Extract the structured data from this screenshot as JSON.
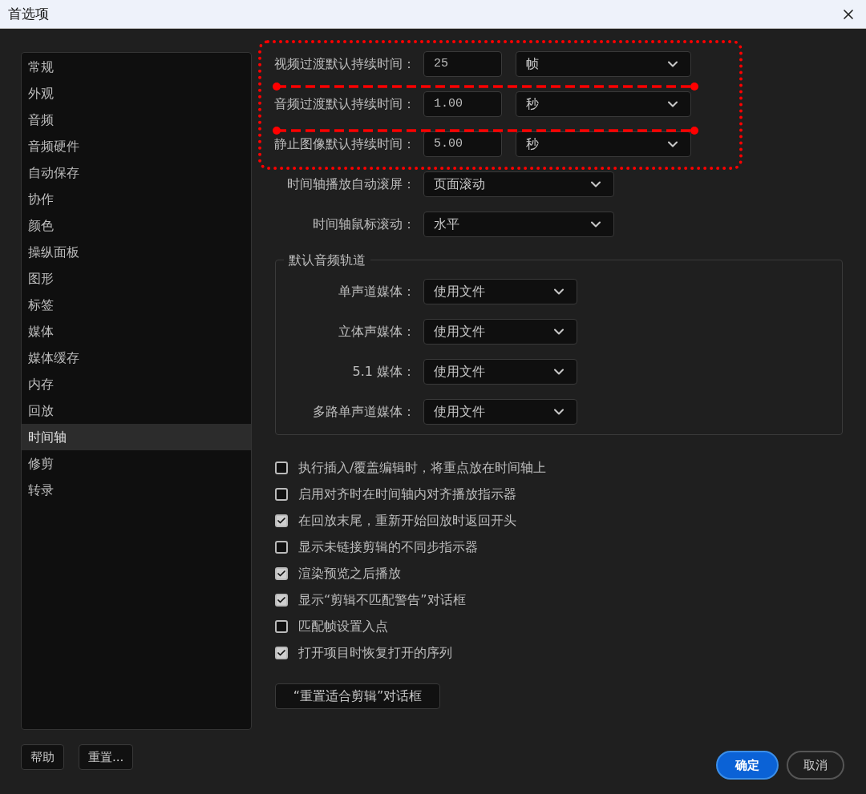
{
  "window": {
    "title": "首选项"
  },
  "sidebar": {
    "items": [
      {
        "label": "常规",
        "selected": false
      },
      {
        "label": "外观",
        "selected": false
      },
      {
        "label": "音频",
        "selected": false
      },
      {
        "label": "音频硬件",
        "selected": false
      },
      {
        "label": "自动保存",
        "selected": false
      },
      {
        "label": "协作",
        "selected": false
      },
      {
        "label": "颜色",
        "selected": false
      },
      {
        "label": "操纵面板",
        "selected": false
      },
      {
        "label": "图形",
        "selected": false
      },
      {
        "label": "标签",
        "selected": false
      },
      {
        "label": "媒体",
        "selected": false
      },
      {
        "label": "媒体缓存",
        "selected": false
      },
      {
        "label": "内存",
        "selected": false
      },
      {
        "label": "回放",
        "selected": false
      },
      {
        "label": "时间轴",
        "selected": true
      },
      {
        "label": "修剪",
        "selected": false
      },
      {
        "label": "转录",
        "selected": false
      }
    ]
  },
  "duration_rows": [
    {
      "label": "视频过渡默认持续时间：",
      "value": "25",
      "unit": "帧"
    },
    {
      "label": "音频过渡默认持续时间：",
      "value": "1.00",
      "unit": "秒"
    },
    {
      "label": "静止图像默认持续时间：",
      "value": "5.00",
      "unit": "秒"
    }
  ],
  "timeline_rows": [
    {
      "label": "时间轴播放自动滚屏：",
      "value": "页面滚动"
    },
    {
      "label": "时间轴鼠标滚动：",
      "value": "水平"
    }
  ],
  "audio_track_group": {
    "title": "默认音频轨道",
    "rows": [
      {
        "label": "单声道媒体：",
        "value": "使用文件"
      },
      {
        "label": "立体声媒体：",
        "value": "使用文件"
      },
      {
        "label": "5.1 媒体：",
        "value": "使用文件"
      },
      {
        "label": "多路单声道媒体：",
        "value": "使用文件"
      }
    ]
  },
  "checkboxes": [
    {
      "label": "执行插入/覆盖编辑时，将重点放在时间轴上",
      "checked": false
    },
    {
      "label": "启用对齐时在时间轴内对齐播放指示器",
      "checked": false
    },
    {
      "label": "在回放末尾，重新开始回放时返回开头",
      "checked": true
    },
    {
      "label": "显示未链接剪辑的不同步指示器",
      "checked": false
    },
    {
      "label": "渲染预览之后播放",
      "checked": true
    },
    {
      "label": "显示“剪辑不匹配警告”对话框",
      "checked": true
    },
    {
      "label": "匹配帧设置入点",
      "checked": false
    },
    {
      "label": "打开项目时恢复打开的序列",
      "checked": true
    }
  ],
  "reset_fit_button": "“重置适合剪辑”对话框",
  "footer": {
    "left_buttons": [
      "帮助",
      "重置..."
    ],
    "ok": "确定",
    "cancel": "取消"
  }
}
